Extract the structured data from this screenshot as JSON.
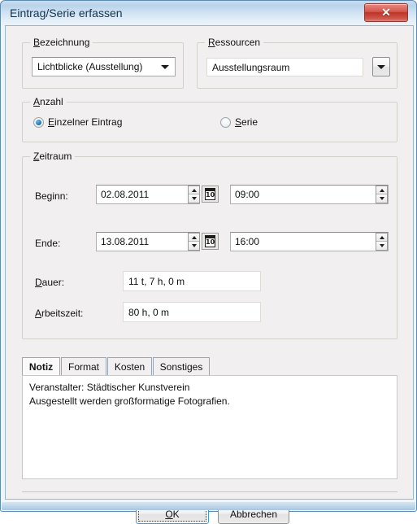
{
  "window": {
    "title": "Eintrag/Serie erfassen",
    "close_glyph": "✕"
  },
  "bezeichnung": {
    "legend_pre": "B",
    "legend_post": "ezeichnung",
    "value": "Lichtblicke (Ausstellung)"
  },
  "ressourcen": {
    "legend_pre": "R",
    "legend_post": "essourcen",
    "value": "Ausstellungsraum"
  },
  "anzahl": {
    "legend_pre": "A",
    "legend_post": "nzahl",
    "option_single_pre": "E",
    "option_single_post": "inzelner Eintrag",
    "option_series_pre": "S",
    "option_series_post": "erie",
    "selected": "Einzelner Eintrag"
  },
  "zeitraum": {
    "legend_pre": "Z",
    "legend_post": "eitraum",
    "beginn_label": "Beginn:",
    "beginn_date": "02.08.2011",
    "beginn_time": "09:00",
    "ende_label": "Ende:",
    "ende_date": "13.08.2011",
    "ende_time": "16:00",
    "dauer_label_pre": "D",
    "dauer_label_post": "auer:",
    "dauer_value": "11 t, 7 h, 0 m",
    "arbeitszeit_label_pre": "A",
    "arbeitszeit_label_post": "rbeitszeit:",
    "arbeitszeit_value": "80 h, 0 m",
    "calendar_day": "10"
  },
  "tabs": [
    {
      "label": "Notiz",
      "active": true
    },
    {
      "label": "Format",
      "active": false
    },
    {
      "label": "Kosten",
      "active": false
    },
    {
      "label": "Sonstiges",
      "active": false
    }
  ],
  "note": {
    "text": "Veranstalter: Städtischer Kunstverein\nAusgestellt werden großformatige Fotografien."
  },
  "footer": {
    "ok_pre": "O",
    "ok_post": "K",
    "cancel_label": "Abbrechen"
  },
  "colors": {
    "titlebar_blue": "#c7dcef",
    "dialog_bg": "#f2eff1",
    "close_red": "#bf3227",
    "radio_blue": "#1a6fb5",
    "focus_blue": "#3c97d4"
  }
}
